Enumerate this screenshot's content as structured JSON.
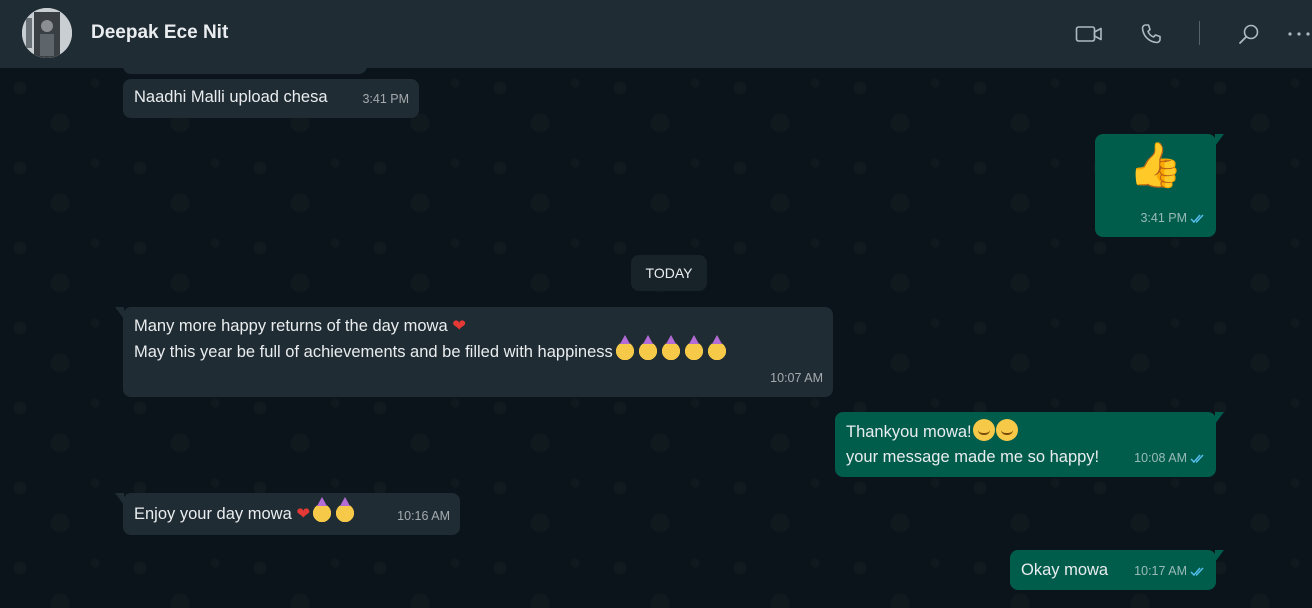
{
  "header": {
    "contact_name": "Deepak Ece Nit",
    "icons": [
      "video-call-icon",
      "voice-call-icon",
      "search-icon",
      "more-options-icon"
    ]
  },
  "messages": [
    {
      "direction": "in",
      "text": "Naadhi Malli upload chesa",
      "time": "3:41 PM"
    },
    {
      "direction": "out",
      "emoji": "👍",
      "time": "3:41 PM",
      "status": "read"
    },
    {
      "direction": "in",
      "line1": "Many more happy returns of the day mowa",
      "line2": "May this year be full of achievements and be filled with happiness",
      "time": "10:07 AM"
    },
    {
      "direction": "out",
      "line1": "Thankyou mowa!",
      "line2": "your message made me so happy!",
      "time": "10:08 AM",
      "status": "read"
    },
    {
      "direction": "in",
      "text": "Enjoy your day mowa",
      "time": "10:16 AM"
    },
    {
      "direction": "out",
      "text": "Okay mowa",
      "time": "10:17 AM",
      "status": "read"
    }
  ],
  "date_divider": "TODAY",
  "colors": {
    "header_bg": "#202c33",
    "chat_bg": "#0b141a",
    "incoming_bubble": "#202c33",
    "outgoing_bubble": "#005c4b",
    "read_tick": "#53bdeb"
  }
}
